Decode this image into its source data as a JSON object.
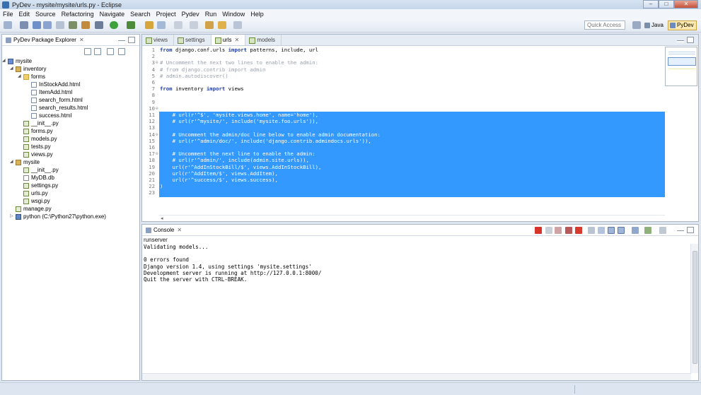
{
  "window": {
    "title": "PyDev - mysite/mysite/urls.py - Eclipse",
    "minimize": "–",
    "maximize": "□",
    "close": "✕"
  },
  "menu": [
    "File",
    "Edit",
    "Source",
    "Refactoring",
    "Navigate",
    "Search",
    "Project",
    "Pydev",
    "Run",
    "Window",
    "Help"
  ],
  "toolbar": {
    "quick_access_placeholder": "Quick Access",
    "perspectives": [
      {
        "label": "Java",
        "active": false
      },
      {
        "label": "PyDev",
        "active": true
      }
    ]
  },
  "explorer": {
    "title": "PyDev Package Explorer",
    "close": "✕",
    "tree": [
      {
        "label": "mysite",
        "level": 0,
        "icon": "project-icon",
        "expanded": true
      },
      {
        "label": "inventory",
        "level": 1,
        "icon": "package-folder-icon",
        "expanded": true
      },
      {
        "label": "forms",
        "level": 2,
        "icon": "folder-icon",
        "expanded": true
      },
      {
        "label": "InStockAdd.html",
        "level": 3,
        "icon": "html-file-icon"
      },
      {
        "label": "ItemAdd.html",
        "level": 3,
        "icon": "html-file-icon"
      },
      {
        "label": "search_form.html",
        "level": 3,
        "icon": "html-file-icon"
      },
      {
        "label": "search_results.html",
        "level": 3,
        "icon": "html-file-icon"
      },
      {
        "label": "success.html",
        "level": 3,
        "icon": "html-file-icon"
      },
      {
        "label": "__init__.py",
        "level": 2,
        "icon": "python-file-icon"
      },
      {
        "label": "forms.py",
        "level": 2,
        "icon": "python-file-icon"
      },
      {
        "label": "models.py",
        "level": 2,
        "icon": "python-file-icon"
      },
      {
        "label": "tests.py",
        "level": 2,
        "icon": "python-file-icon"
      },
      {
        "label": "views.py",
        "level": 2,
        "icon": "python-file-icon"
      },
      {
        "label": "mysite",
        "level": 1,
        "icon": "package-folder-icon",
        "expanded": true
      },
      {
        "label": "__init__.py",
        "level": 2,
        "icon": "python-file-icon"
      },
      {
        "label": "MyDB.db",
        "level": 2,
        "icon": "db-file-icon"
      },
      {
        "label": "settings.py",
        "level": 2,
        "icon": "python-file-icon"
      },
      {
        "label": "urls.py",
        "level": 2,
        "icon": "python-file-icon"
      },
      {
        "label": "wsgi.py",
        "level": 2,
        "icon": "python-file-icon"
      },
      {
        "label": "manage.py",
        "level": 1,
        "icon": "python-file-icon"
      },
      {
        "label": "python  (C:\\Python27\\python.exe)",
        "level": 1,
        "icon": "interpreter-icon",
        "expanded": false
      }
    ]
  },
  "editor": {
    "tabs": [
      {
        "label": "views",
        "active": false
      },
      {
        "label": "settings",
        "active": false
      },
      {
        "label": "urls",
        "active": true,
        "close": "✕"
      },
      {
        "label": "models",
        "active": false
      }
    ],
    "lines": [
      {
        "n": "1",
        "text": "from django.conf.urls import patterns, include, url",
        "selected": false
      },
      {
        "n": "2",
        "text": "",
        "selected": false
      },
      {
        "n": "3",
        "text": "# Uncomment the next two lines to enable the admin:",
        "selected": false,
        "comment": true,
        "fold": "⊖"
      },
      {
        "n": "4",
        "text": "# from django.contrib import admin",
        "selected": false,
        "comment": true
      },
      {
        "n": "5",
        "text": "# admin.autodiscover()",
        "selected": false,
        "comment": true
      },
      {
        "n": "6",
        "text": "",
        "selected": false
      },
      {
        "n": "7",
        "text": "from inventory import views",
        "selected": false
      },
      {
        "n": "8",
        "text": "",
        "selected": false
      },
      {
        "n": "9",
        "text": "urlpatterns = patterns('',",
        "selected": true
      },
      {
        "n": "10",
        "text": "    # Examples:",
        "selected": true,
        "fold": "⊖"
      },
      {
        "n": "11",
        "text": "    # url(r'^$', 'mysite.views.home', name='home'),",
        "selected": true
      },
      {
        "n": "12",
        "text": "    # url(r'^mysite/', include('mysite.foo.urls')),",
        "selected": true
      },
      {
        "n": "13",
        "text": "",
        "selected": true
      },
      {
        "n": "14",
        "text": "    # Uncomment the admin/doc line below to enable admin documentation:",
        "selected": true,
        "fold": "⊖"
      },
      {
        "n": "15",
        "text": "    # url(r'^admin/doc/', include('django.contrib.admindocs.urls')),",
        "selected": true
      },
      {
        "n": "16",
        "text": "",
        "selected": true
      },
      {
        "n": "17",
        "text": "    # Uncomment the next line to enable the admin:",
        "selected": true,
        "fold": "⊖"
      },
      {
        "n": "18",
        "text": "    # url(r'^admin/', include(admin.site.urls)),",
        "selected": true
      },
      {
        "n": "19",
        "text": "    url(r'^AddInStockBill/$', views.AddInStockBill),",
        "selected": true
      },
      {
        "n": "20",
        "text": "    url(r'^AddItem/$', views.AddItem),",
        "selected": true
      },
      {
        "n": "21",
        "text": "    url(r'^success/$', views.success),",
        "selected": true
      },
      {
        "n": "22",
        "text": ")",
        "selected": true
      },
      {
        "n": "23",
        "text": "",
        "selected": false
      }
    ]
  },
  "console": {
    "tab_label": "Console",
    "close": "✕",
    "process_name": "runserver",
    "lines": [
      "Validating models...",
      "",
      "0 errors found",
      "Django version 1.4, using settings 'mysite.settings'",
      "Development server is running at http://127.0.0.1:8000/",
      "Quit the server with CTRL-BREAK."
    ]
  },
  "colors": {
    "selection": "#3399ff",
    "keyword": "#1f3ea8",
    "comment": "#9aa1ad",
    "terminate_red": "#d9342b"
  }
}
